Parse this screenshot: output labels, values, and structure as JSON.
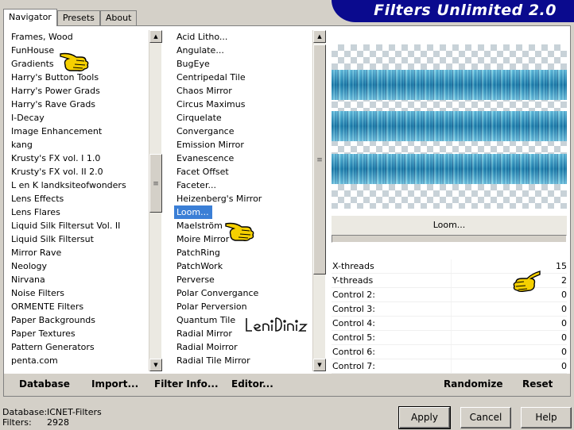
{
  "tabs": [
    {
      "label": "Navigator",
      "active": true
    },
    {
      "label": "Presets",
      "active": false
    },
    {
      "label": "About",
      "active": false
    }
  ],
  "banner": {
    "title": "Filters Unlimited 2.0",
    "color": "#0a0a8e"
  },
  "categories": [
    "Frames, Wood",
    "FunHouse",
    "Gradients",
    "Harry's Button Tools",
    "Harry's Power Grads",
    "Harry's Rave Grads",
    "I-Decay",
    "Image Enhancement",
    "kang",
    "Krusty's FX vol. I 1.0",
    "Krusty's FX vol. II 2.0",
    "L en K landksiteofwonders",
    "Lens Effects",
    "Lens Flares",
    "Liquid Silk Filtersut Vol. II",
    "Liquid Silk Filtersut",
    "Mirror Rave",
    "Neology",
    "Nirvana",
    "Noise Filters",
    "ORMENTE Filters",
    "Paper Backgrounds",
    "Paper Textures",
    "Pattern Generators",
    "penta.com"
  ],
  "filters": [
    "Acid Litho...",
    "Angulate...",
    "BugEye",
    "Centripedal Tile",
    "Chaos Mirror",
    "Circus Maximus",
    "Cirquelate",
    "Convergance",
    "Emission Mirror",
    "Evanescence",
    "Facet Offset",
    "Faceter...",
    "Heizenberg's Mirror",
    "Loom...",
    "Maelström",
    "Moire Mirror",
    "PatchRing",
    "PatchWork",
    "Perverse",
    "Polar Convergance",
    "Polar Perversion",
    "Quantum Tile",
    "Radial Mirror",
    "Radial Moirror",
    "Radial Tile Mirror"
  ],
  "selected_filter": "Loom...",
  "filter_name": "Loom...",
  "controls": [
    {
      "label": "X-threads",
      "value": "15"
    },
    {
      "label": "Y-threads",
      "value": "2"
    },
    {
      "label": "Control 2:",
      "value": "0"
    },
    {
      "label": "Control 3:",
      "value": "0"
    },
    {
      "label": "Control 4:",
      "value": "0"
    },
    {
      "label": "Control 5:",
      "value": "0"
    },
    {
      "label": "Control 6:",
      "value": "0"
    },
    {
      "label": "Control 7:",
      "value": "0"
    }
  ],
  "bottom_bar": {
    "database": "Database",
    "import": "Import...",
    "filter_info": "Filter Info...",
    "editor": "Editor...",
    "randomize": "Randomize",
    "reset": "Reset"
  },
  "status": {
    "database_label": "Database:",
    "database_value": "ICNET-Filters",
    "filters_label": "Filters:",
    "filters_value": "2928"
  },
  "buttons": {
    "apply": "Apply",
    "cancel": "Cancel",
    "help": "Help"
  },
  "watermark": "LeniDiniz",
  "colors": {
    "selection": "#3b7fd6",
    "pointer": "#f5d000"
  }
}
